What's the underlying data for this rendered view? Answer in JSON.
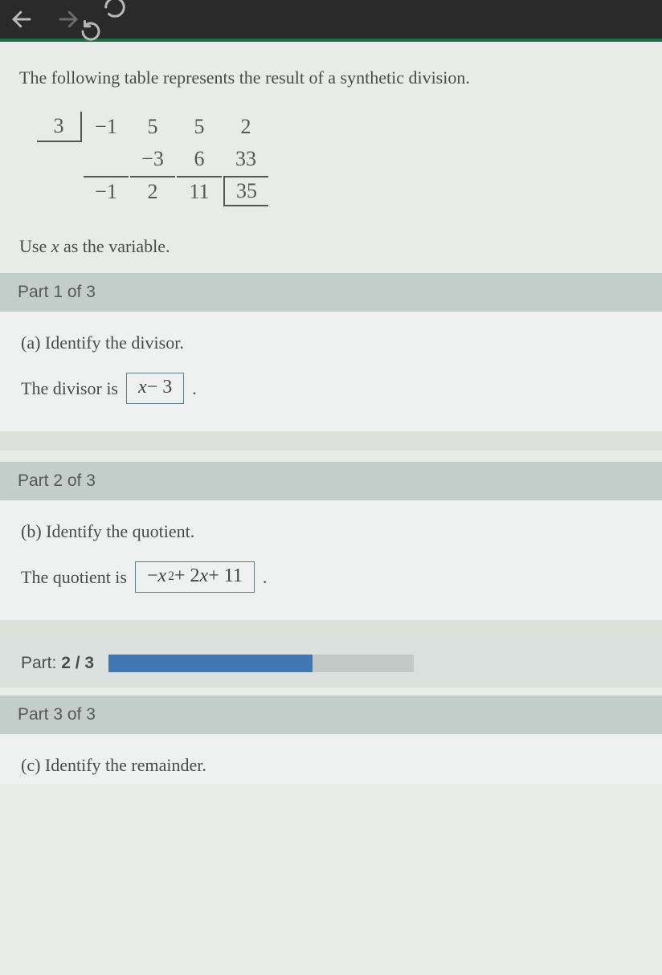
{
  "nav": {
    "back_icon": "back-arrow",
    "forward_icon": "forward-arrow",
    "reload_icon": "reload"
  },
  "intro": "The following table represents the result of a synthetic division.",
  "tableau": {
    "divisor": "3",
    "r1": [
      "−1",
      "5",
      "5",
      "2"
    ],
    "r2": [
      "",
      "−3",
      "6",
      "33"
    ],
    "r3": [
      "−1",
      "2",
      "11",
      "35"
    ]
  },
  "use_var_prefix": "Use ",
  "use_var_x": "x",
  "use_var_suffix": " as the variable.",
  "parts": {
    "p1": {
      "header": "Part 1 of 3",
      "prompt": "(a) Identify the divisor.",
      "label_prefix": "The divisor is ",
      "answer_x": "x",
      "answer_rest": " − 3",
      "label_suffix": "."
    },
    "p2": {
      "header": "Part 2 of 3",
      "prompt": "(b) Identify the quotient.",
      "label_prefix": "The quotient is ",
      "ans_neg": "−",
      "ans_x1": "x",
      "ans_exp": "2",
      "ans_mid": " + 2",
      "ans_x2": "x",
      "ans_end": " + 11",
      "label_suffix": "."
    },
    "progress": {
      "label_prefix": "Part: ",
      "current": "2",
      "sep": " / ",
      "total": "3",
      "percent": 66.7
    },
    "p3": {
      "header": "Part 3 of 3",
      "prompt": "(c) Identify the remainder."
    }
  }
}
